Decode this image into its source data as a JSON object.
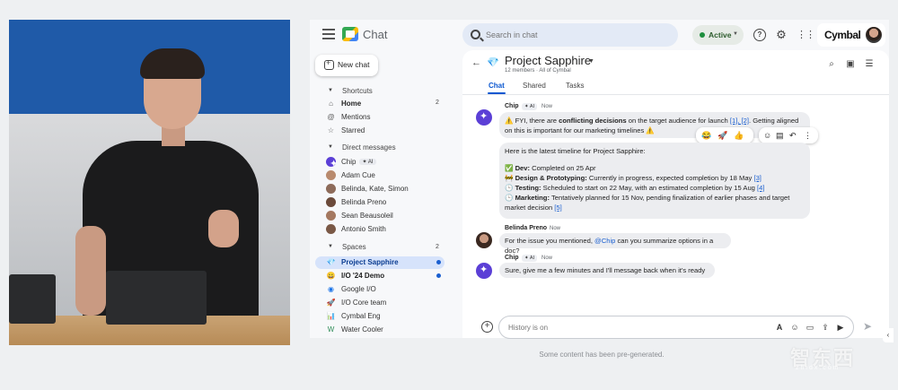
{
  "app": {
    "name": "Chat"
  },
  "search": {
    "placeholder": "Search in chat"
  },
  "status": {
    "label": "Active"
  },
  "brand": {
    "name": "Cymbal"
  },
  "sidebar": {
    "new_chat": "New chat",
    "shortcuts": {
      "heading": "Shortcuts",
      "items": [
        {
          "label": "Home",
          "icon": "home-icon",
          "count": "2"
        },
        {
          "label": "Mentions",
          "icon": "at-icon"
        },
        {
          "label": "Starred",
          "icon": "star-icon"
        }
      ]
    },
    "direct_messages": {
      "heading": "Direct messages",
      "items": [
        {
          "label": "Chip",
          "tag": "✦ AI",
          "avatar": "gemini-avatar"
        },
        {
          "label": "Adam Cue"
        },
        {
          "label": "Belinda, Kate, Simon"
        },
        {
          "label": "Belinda Preno"
        },
        {
          "label": "Sean Beausoleil"
        },
        {
          "label": "Antonio Smith"
        }
      ]
    },
    "spaces": {
      "heading": "Spaces",
      "count": "2",
      "items": [
        {
          "label": "Project Sapphire",
          "active": true,
          "unread": true
        },
        {
          "label": "I/O '24 Demo",
          "unread": true
        },
        {
          "label": "Google I/O"
        },
        {
          "label": "I/O Core team"
        },
        {
          "label": "Cymbal Eng"
        },
        {
          "label": "Water Cooler"
        }
      ]
    }
  },
  "space": {
    "title": "Project Sapphire",
    "subtitle": "12 members · All of Cymbal",
    "tabs": [
      "Chat",
      "Shared",
      "Tasks"
    ]
  },
  "messages": [
    {
      "sender": "Chip",
      "ai_tag": "✦ AI",
      "time": "Now",
      "line1_pre": "⚠️ FYI, there are ",
      "line1_bold": "conflicting decisions",
      "line1_post": " on the target audience for launch ",
      "line1_refs": "[1], [2]",
      "line1_tail": ". Getting aligned",
      "line2": "on this is important for our marketing timelines ⚠️",
      "timeline_intro": "Here is the latest timeline for Project Sapphire:",
      "dev_label": "Dev:",
      "dev_text": " Completed on 25 Apr",
      "design_label": "Design & Prototyping:",
      "design_text": " Currently in progress, expected completion by 18 May ",
      "design_ref": "[3]",
      "testing_label": "Testing:",
      "testing_text": " Scheduled to start on 22 May, with an estimated completion by 15 Aug ",
      "testing_ref": "[4]",
      "marketing_label": "Marketing:",
      "marketing_text": " Tentatively planned for 15 Nov, pending finalization of earlier phases and target",
      "marketing_text2": "market decision ",
      "marketing_ref": "[5]"
    },
    {
      "sender": "Belinda Preno",
      "time": "Now",
      "text_pre": "For the issue you mentioned, ",
      "mention": "@Chip",
      "text_post": " can you summarize options in a doc?"
    },
    {
      "sender": "Chip",
      "ai_tag": "✦ AI",
      "time": "Now",
      "text": "Sure, give me a few minutes and I'll message back when it's ready"
    }
  ],
  "composer": {
    "placeholder": "History is on"
  },
  "footnote": "Some content has been pre-generated.",
  "watermark": {
    "main": "智东西",
    "sub": "zhidx.com"
  }
}
